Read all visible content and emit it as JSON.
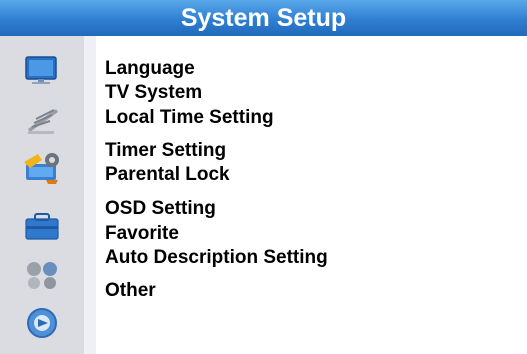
{
  "header": {
    "title": "System Setup"
  },
  "sidebar": {
    "icons": [
      {
        "name": "tv-icon"
      },
      {
        "name": "antenna-icon"
      },
      {
        "name": "system-setup-icon"
      },
      {
        "name": "toolbox-icon"
      },
      {
        "name": "media-icon"
      },
      {
        "name": "settings-disc-icon"
      }
    ]
  },
  "menu": {
    "items": [
      {
        "label": "Language"
      },
      {
        "label": "TV System"
      },
      {
        "label": "Local Time Setting"
      },
      {
        "label": "Timer Setting"
      },
      {
        "label": "Parental Lock"
      },
      {
        "label": "OSD Setting"
      },
      {
        "label": "Favorite"
      },
      {
        "label": "Auto Description Setting"
      },
      {
        "label": "Other"
      }
    ]
  }
}
